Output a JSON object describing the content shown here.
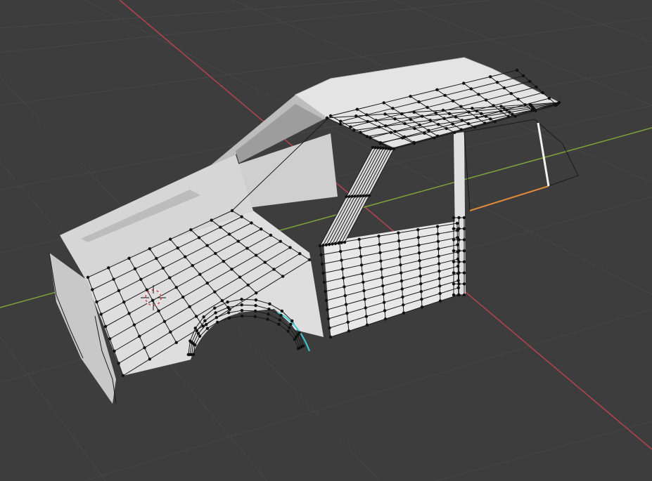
{
  "viewport": {
    "background": "#3d3d3d",
    "grid_color": "#474747",
    "x_axis_color": "#b4434f",
    "y_axis_color": "#7fa33b",
    "body_color": "#e6e6e6",
    "vertex_color": "#111111",
    "selected_edge_color": "#e08a3c",
    "active_edge_color": "#3ccfd6",
    "cursor_color": "#d44a4a"
  },
  "scene": {
    "mode": "edit-mode",
    "object": "car-body-mesh",
    "icons": [
      "3d-cursor-icon"
    ]
  }
}
